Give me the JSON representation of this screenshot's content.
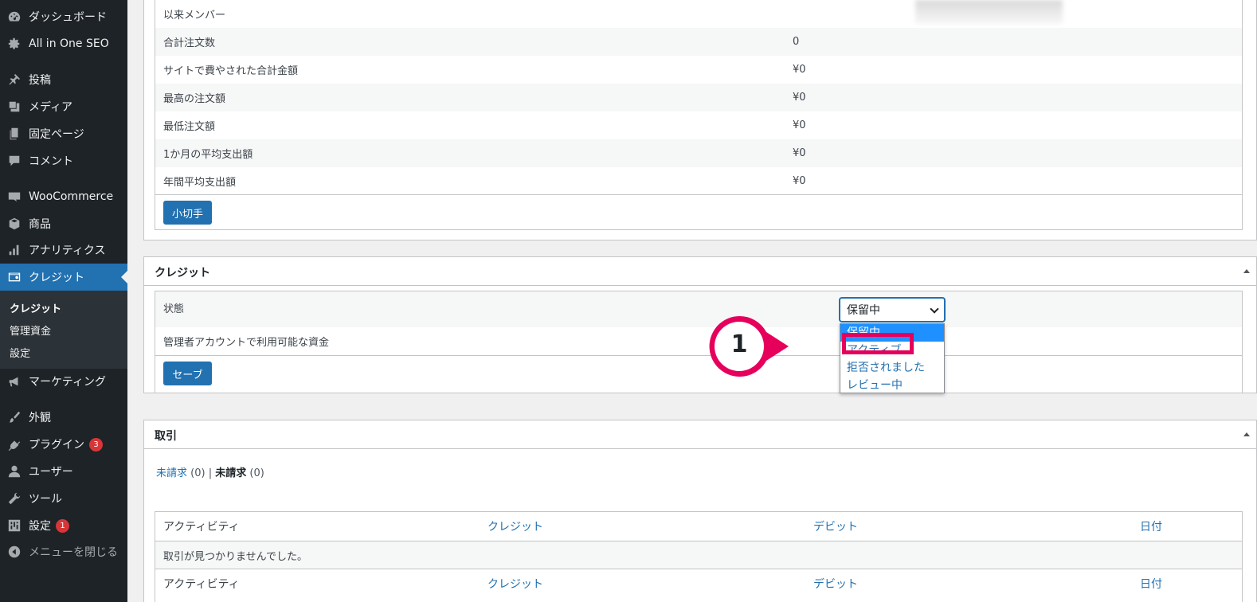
{
  "sidebar": {
    "items": [
      {
        "label": "ダッシュボード",
        "icon": "dashboard-icon"
      },
      {
        "label": "All in One SEO",
        "icon": "gear-icon"
      },
      {
        "label": "投稿",
        "icon": "pin-icon"
      },
      {
        "label": "メディア",
        "icon": "media-icon"
      },
      {
        "label": "固定ページ",
        "icon": "page-icon"
      },
      {
        "label": "コメント",
        "icon": "comment-icon"
      },
      {
        "label": "WooCommerce",
        "icon": "woo-icon"
      },
      {
        "label": "商品",
        "icon": "box-icon"
      },
      {
        "label": "アナリティクス",
        "icon": "bar-chart-icon"
      },
      {
        "label": "クレジット",
        "icon": "credit-card-icon"
      },
      {
        "label": "マーケティング",
        "icon": "megaphone-icon"
      },
      {
        "label": "外観",
        "icon": "brush-icon"
      },
      {
        "label": "プラグイン",
        "icon": "plugin-icon",
        "badge": "3"
      },
      {
        "label": "ユーザー",
        "icon": "user-icon"
      },
      {
        "label": "ツール",
        "icon": "wrench-icon"
      },
      {
        "label": "設定",
        "icon": "settings-icon",
        "badge": "1"
      },
      {
        "label": "メニューを閉じる",
        "icon": "collapse-icon"
      }
    ],
    "submenu": [
      "クレジット",
      "管理資金",
      "設定"
    ]
  },
  "summary": {
    "rows": [
      {
        "label": "以来メンバー",
        "value": ""
      },
      {
        "label": "合計注文数",
        "value": "0"
      },
      {
        "label": "サイトで費やされた合計金額",
        "value": "¥0"
      },
      {
        "label": "最高の注文額",
        "value": "¥0"
      },
      {
        "label": "最低注文額",
        "value": "¥0"
      },
      {
        "label": "1か月の平均支出額",
        "value": "¥0"
      },
      {
        "label": "年間平均支出額",
        "value": "¥0"
      }
    ],
    "check_button": "小切手"
  },
  "credit": {
    "title": "クレジット",
    "status_label": "状態",
    "status_value": "保留中",
    "funds_label": "管理者アカウントで利用可能な資金",
    "options": [
      "保留中",
      "アクティブ",
      "拒否されました",
      "レビュー中"
    ],
    "save_button": "セーブ",
    "callout_number": "1"
  },
  "transactions": {
    "title": "取引",
    "filter_unbilled": "未請求",
    "filter_unbilled_count": "(0)",
    "filter_separator": "|",
    "filter_unbilled2": "未請求",
    "filter_unbilled2_count": "(0)",
    "columns": [
      "アクティビティ",
      "クレジット",
      "デビット",
      "日付"
    ],
    "empty": "取引が見つかりませんでした。"
  },
  "colors": {
    "accent": "#2271b1",
    "highlight": "#e6005c",
    "sidebar": "#1d2327"
  }
}
